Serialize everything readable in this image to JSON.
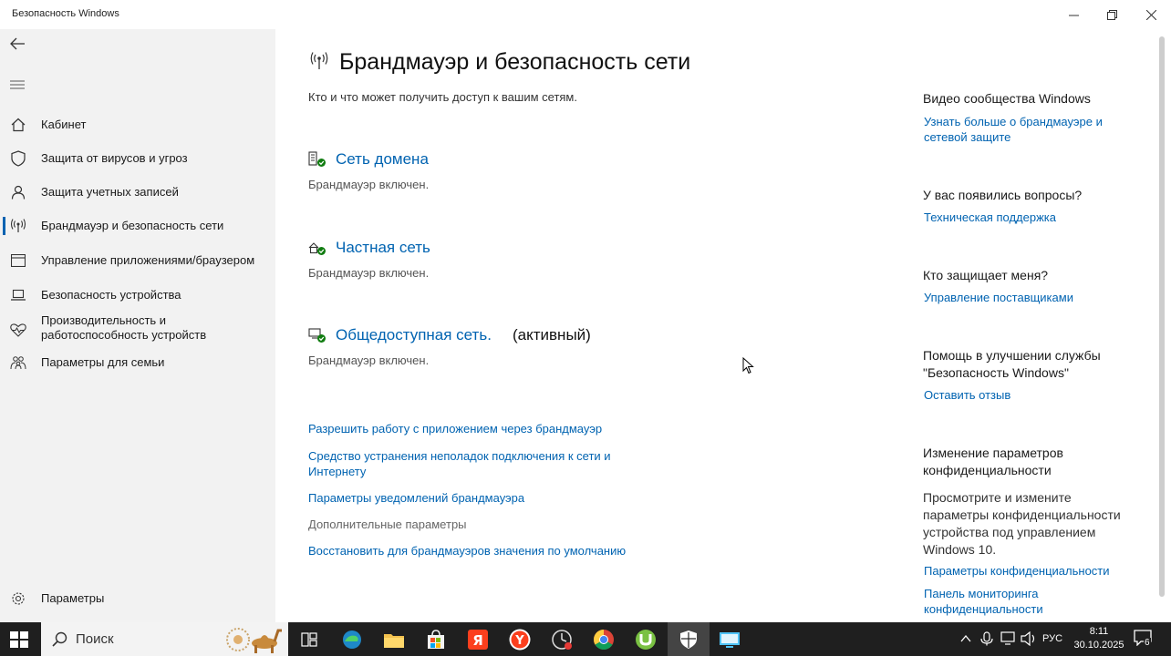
{
  "window": {
    "title": "Безопасность Windows"
  },
  "sidebar": {
    "items": [
      {
        "label": "Кабинет",
        "icon": "home-icon"
      },
      {
        "label": "Защита от вирусов и угроз",
        "icon": "shield-icon"
      },
      {
        "label": "Защита учетных записей",
        "icon": "person-icon"
      },
      {
        "label": "Брандмауэр и безопасность сети",
        "icon": "wifi-antenna-icon",
        "active": true
      },
      {
        "label": "Управление приложениями/браузером",
        "icon": "browser-window-icon"
      },
      {
        "label": "Безопасность устройства",
        "icon": "laptop-icon"
      },
      {
        "label": "Производительность и работоспособность устройств",
        "label_line1": "Производительность и",
        "label_line2": "работоспособность устройств",
        "icon": "heart-pulse-icon"
      },
      {
        "label": "Параметры для семьи",
        "icon": "family-icon"
      }
    ],
    "settings_label": "Параметры"
  },
  "main": {
    "title": "Брандмауэр и безопасность сети",
    "subtitle": "Кто и что может получить доступ к вашим сетям.",
    "networks": [
      {
        "name": "Сеть домена",
        "status": "Брандмауэр включен.",
        "icon": "domain-network-icon"
      },
      {
        "name": "Частная сеть",
        "status": "Брандмауэр включен.",
        "icon": "private-network-icon"
      },
      {
        "name": "Общедоступная сеть.",
        "active_label": "(активный)",
        "status": "Брандмауэр включен.",
        "icon": "public-network-icon"
      }
    ],
    "links": {
      "allow_app": "Разрешить работу с приложением через брандмауэр",
      "troubleshoot_line1": "Средство устранения неполадок подключения к сети и",
      "troubleshoot_line2": "Интернету",
      "notifications": "Параметры уведомлений брандмауэра",
      "advanced": "Дополнительные параметры",
      "restore": "Восстановить для брандмауэров значения по умолчанию"
    }
  },
  "right_panel": {
    "community_heading": "Видео сообщества Windows",
    "community_link_line1": "Узнать больше о брандмауэре и",
    "community_link_line2": "сетевой защите",
    "questions_heading": "У вас появились вопросы?",
    "support_link": "Техническая поддержка",
    "who_heading": "Кто защищает меня?",
    "providers_link": "Управление поставщиками",
    "improve_line1": "Помощь в улучшении службы",
    "improve_line2": "\"Безопасность Windows\"",
    "feedback_link": "Оставить отзыв",
    "privacy_heading_line1": "Изменение параметров",
    "privacy_heading_line2": "конфиденциальности",
    "privacy_text_line1": "Просмотрите и измените",
    "privacy_text_line2": "параметры конфиденциальности",
    "privacy_text_line3": "устройства под управлением",
    "privacy_text_line4": "Windows 10.",
    "privacy_settings_link": "Параметры конфиденциальности",
    "privacy_dashboard_line1": "Панель мониторинга",
    "privacy_dashboard_line2": "конфиденциальности"
  },
  "taskbar": {
    "search_placeholder": "Поиск",
    "language": "РУС",
    "time": "8:11",
    "date": "30.10.2025",
    "notifications_count": "6",
    "apps": [
      "task-view-icon",
      "edge-icon",
      "file-explorer-icon",
      "store-icon",
      "yandex-icon",
      "yandex-browser-icon",
      "screen-capture-icon",
      "chrome-icon",
      "utorrent-icon",
      "windows-security-icon",
      "remote-desktop-icon"
    ]
  },
  "colors": {
    "accent": "#0063b1",
    "sidebar_bg": "#f2f2f2",
    "taskbar_bg": "#1f1f1f",
    "status_green": "#107c10"
  }
}
